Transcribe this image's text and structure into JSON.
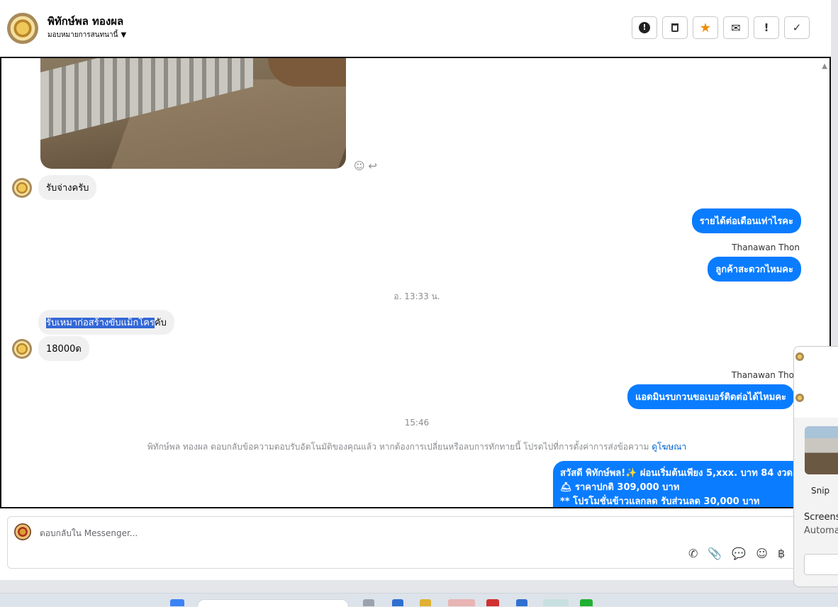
{
  "header": {
    "contact_name": "พิทักษ์พล ทองผล",
    "assign_label": "มอบหมายการสนทนานี้",
    "actions": [
      {
        "name": "spam-button",
        "icon": "alert-circle-icon",
        "glyph": "⚠"
      },
      {
        "name": "delete-button",
        "icon": "trash-icon",
        "glyph": "🗑"
      },
      {
        "name": "star-button",
        "icon": "star-icon",
        "glyph": "★"
      },
      {
        "name": "mark-unread-button",
        "icon": "envelope-icon",
        "glyph": "✉"
      },
      {
        "name": "follow-up-button",
        "icon": "exclamation-icon",
        "glyph": "!"
      },
      {
        "name": "mark-done-button",
        "icon": "check-icon",
        "glyph": "✓"
      }
    ]
  },
  "messages": {
    "m1": "รับจ่างครับ",
    "m2": "รายได้ต่อเดือนเท่าไรคะ",
    "sender1": "Thanawan Thon",
    "m3": "ลูกค้าสะดวกไหมคะ",
    "time1": "อ. 13:33 น.",
    "m4_selected": "รับเหมาก่อสร้างขับแม็กโคร",
    "m4_rest": "คับ",
    "m5": "18000ด",
    "sender2": "Thanawan Tho",
    "m6": "แอดมินรบกวนขอเบอร์ติดต่อได้ไหมคะ",
    "time2": "15:46",
    "system_note": "พิทักษ์พล ทองผล ตอบกลับข้อความตอบรับอัตโนมัติของคุณแล้ว หากต้องการเปลี่ยนหรือลบการทักทายนี้ โปรดไปที่การตั้งค่าการส่งข้อความ",
    "system_link": "ดูโฆษณา",
    "promo_line1": "สวัสดี พิทักษ์พล!✨  ผ่อนเริ่มต้นเพียง 5,xxx. บาท 84 งวด",
    "promo_line2": "🛎 ราคาปกติ 309,000 บาท",
    "promo_line3": "** โปรโมชั่นข้าวแลกลด รับส่วนลด 30,000 บาท"
  },
  "composer": {
    "placeholder": "ตอบกลับใน Messenger..."
  },
  "popup": {
    "snip_label": "Snip",
    "line1": "Screens",
    "line2": "Automa"
  }
}
